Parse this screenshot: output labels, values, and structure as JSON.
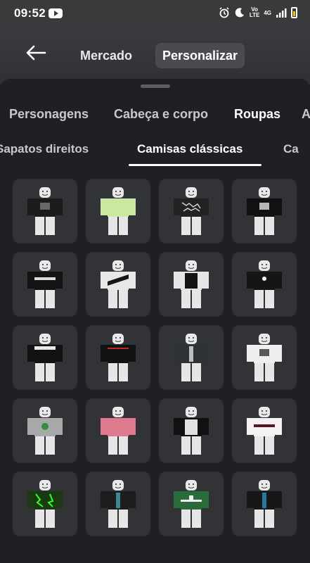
{
  "status": {
    "time": "09:52",
    "volte_label": "Vo\nLTE",
    "network": "4G"
  },
  "nav": {
    "tabs": [
      "Mercado",
      "Personalizar"
    ]
  },
  "categories": [
    "Personagens",
    "Cabeça e corpo",
    "Roupas",
    "A"
  ],
  "subcategories": [
    "Sapatos direitos",
    "Camisas clássicas",
    "Ca"
  ],
  "items": [
    {
      "shirt": "#1b1b1b",
      "accent": "#7a7a7a",
      "pattern": "print"
    },
    {
      "shirt": "#cbe8a2",
      "accent": "#b8d68e",
      "pattern": "plain"
    },
    {
      "shirt": "#222",
      "accent": "#d8d8d8",
      "pattern": "marble"
    },
    {
      "shirt": "#111",
      "accent": "#e0e0e0",
      "pattern": "print"
    },
    {
      "shirt": "#141414",
      "accent": "#dcdcdc",
      "pattern": "stripe"
    },
    {
      "shirt": "#e8e8e8",
      "accent": "#151515",
      "pattern": "sash"
    },
    {
      "shirt": "#e6e6e6",
      "accent": "#141414",
      "pattern": "vest"
    },
    {
      "shirt": "#151515",
      "accent": "#ffffff",
      "pattern": "heart"
    },
    {
      "shirt": "#121212",
      "accent": "#e8e8e8",
      "pattern": "collar"
    },
    {
      "shirt": "#121212",
      "accent": "#c0282e",
      "pattern": "redline"
    },
    {
      "shirt": "#2c3236",
      "accent": "#b8c0c4",
      "pattern": "jacket"
    },
    {
      "shirt": "#efefef",
      "accent": "#333",
      "pattern": "print"
    },
    {
      "shirt": "#a8a8a8",
      "accent": "#3c8a3c",
      "pattern": "emblem"
    },
    {
      "shirt": "#e07a8e",
      "accent": "#9fd7df",
      "pattern": "plain"
    },
    {
      "shirt": "#111",
      "accent": "#e0e0e0",
      "pattern": "vest"
    },
    {
      "shirt": "#f2f2f2",
      "accent": "#5a1424",
      "pattern": "band"
    },
    {
      "shirt": "#1a3a14",
      "accent": "#39ff24",
      "pattern": "green"
    },
    {
      "shirt": "#1d1d1d",
      "accent": "#3a8a9a",
      "pattern": "jacket"
    },
    {
      "shirt": "#2b6b3b",
      "accent": "#f0f0f0",
      "pattern": "jersey"
    },
    {
      "shirt": "#171717",
      "accent": "#2a7aa0",
      "pattern": "jacket"
    }
  ]
}
